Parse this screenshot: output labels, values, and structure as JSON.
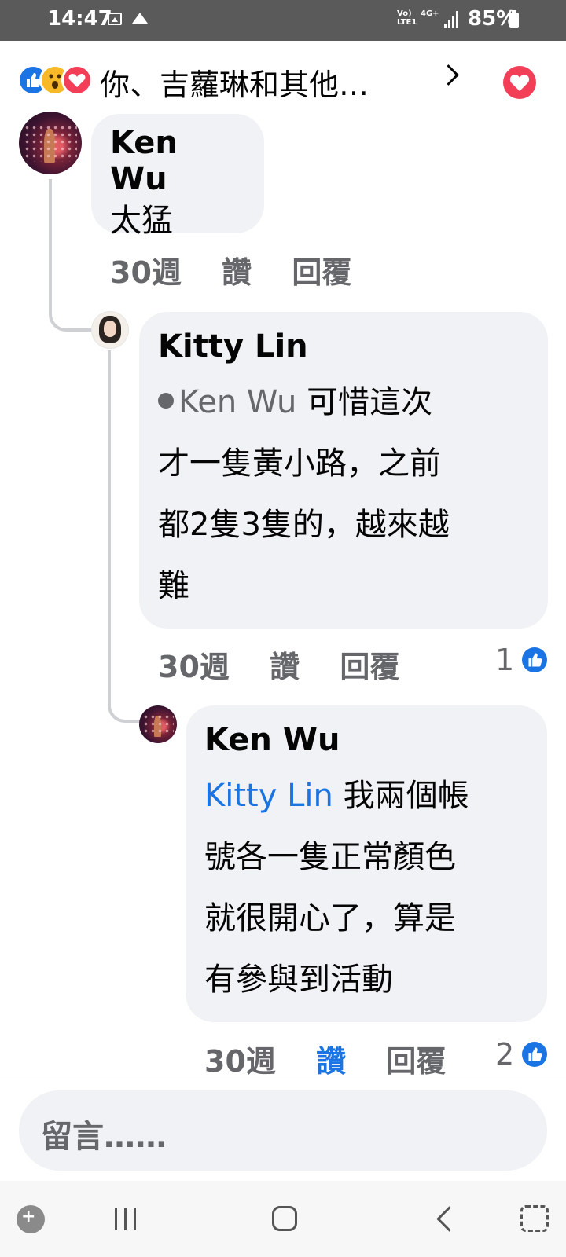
{
  "status_bar": {
    "time": "14:47",
    "network_top": "Vo)",
    "network_bottom": "LTE1",
    "network_type": "4G+",
    "battery": "85%"
  },
  "header": {
    "reactions": [
      "like-icon",
      "wow-icon",
      "love-icon"
    ],
    "title": "你、吉蘿琳和其他…",
    "heart_icon": "heart-icon"
  },
  "thread": {
    "comments": [
      {
        "author": "Ken Wu",
        "text": "太猛",
        "time": "30週",
        "like_label": "讚",
        "reply_label": "回覆"
      },
      {
        "author": "Kitty Lin",
        "mention": "Ken Wu",
        "line1": "可惜這次",
        "line2": "才一隻黃小路，之前",
        "line3": "都2隻3隻的，越來越",
        "line4": "難",
        "time": "30週",
        "like_label": "讚",
        "reply_label": "回覆",
        "reaction_count": "1"
      },
      {
        "author": "Ken Wu",
        "mention": "Kitty Lin",
        "line1": "我兩個帳",
        "line2": "號各一隻正常顏色",
        "line3": "就很開心了，算是",
        "line4": "有參與到活動",
        "time": "30週",
        "like_label": "讚",
        "liked": true,
        "reply_label": "回覆",
        "reaction_count": "2"
      }
    ]
  },
  "composer": {
    "placeholder": "留言……"
  },
  "colors": {
    "facebook_blue": "#1b74e4",
    "bubble_bg": "#f0f2f5",
    "secondary_text": "#65676b",
    "love_red": "#f33e58"
  }
}
